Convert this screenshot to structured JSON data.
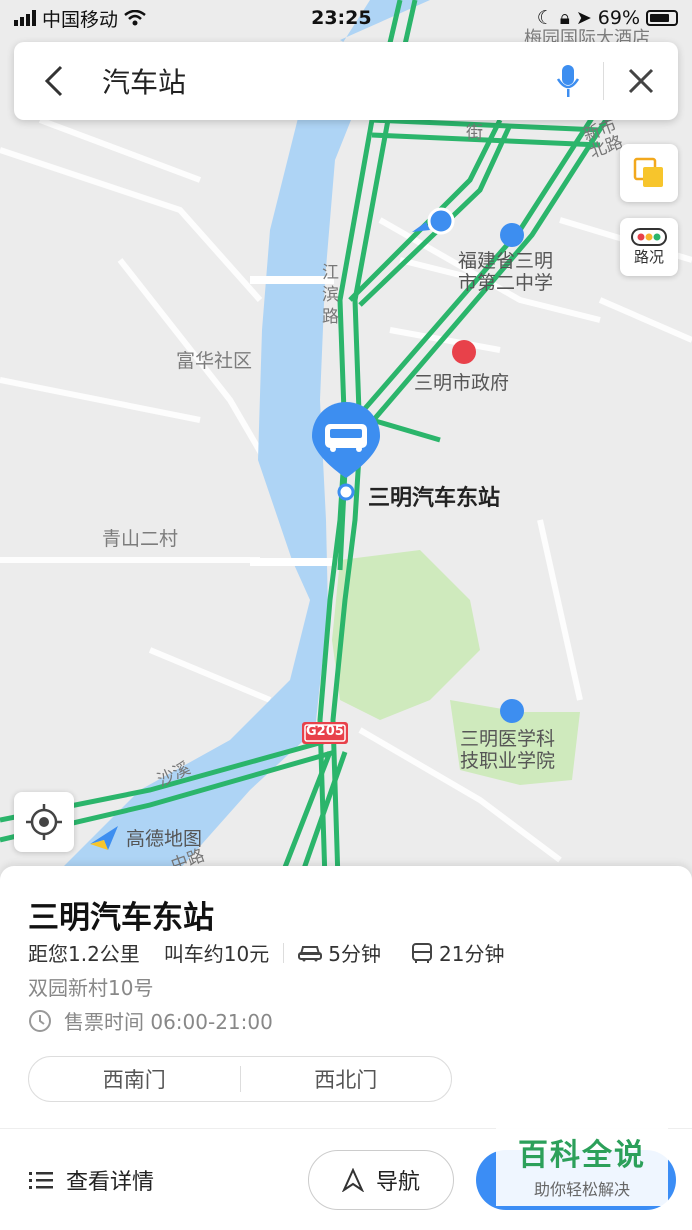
{
  "status_bar": {
    "carrier": "中国移动",
    "time": "23:25",
    "battery": "69%"
  },
  "search": {
    "query": "汽车站"
  },
  "map": {
    "traffic_label": "路况",
    "logo_text": "高德地图",
    "labels": {
      "hotel": "梅园国际大酒店",
      "school": "福建省三明市第二中学",
      "government": "三明市政府",
      "community_fuhua": "富华社区",
      "village_qingshan": "青山二村",
      "station": "三明汽车东站",
      "college": "三明医学科技职业学院",
      "road_jiangbin": "江滨路",
      "road_xinshi": "新市北路",
      "road_jie": "街",
      "highway": "G205",
      "river": "沙溪",
      "road_bottom": "中路"
    },
    "colors": {
      "water": "#aed4f5",
      "green": "#cfeabd",
      "road": "#2bb56b",
      "marker": "#3d8ef0"
    }
  },
  "poi": {
    "name": "三明汽车东站",
    "distance": "距您1.2公里",
    "taxi": "叫车约10元",
    "drive_time": "5分钟",
    "bus_time": "21分钟",
    "address": "双园新村10号",
    "hours": "售票时间 06:00-21:00",
    "gates": [
      "西南门",
      "西北门"
    ]
  },
  "actions": {
    "details": "查看详情",
    "navigate": "导航"
  },
  "watermark": {
    "title": "百科全说",
    "subtitle": "助你轻松解决"
  }
}
